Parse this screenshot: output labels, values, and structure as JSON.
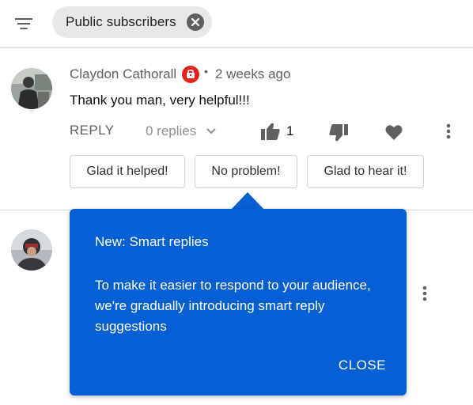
{
  "filter": {
    "chip_label": "Public subscribers",
    "icon": "filter-icon",
    "close_icon": "close-icon"
  },
  "comments": [
    {
      "author": "Claydon Cathorall",
      "badge_icon": "channel-owner-icon",
      "separator": "•",
      "time": "2 weeks ago",
      "text": "Thank you man, very helpful!!!",
      "actions": {
        "reply_label": "REPLY",
        "replies_label": "0 replies",
        "like_count": "1"
      },
      "smart_replies": [
        "Glad it helped!",
        "No problem!",
        "Glad to hear it!"
      ]
    }
  ],
  "popover": {
    "title": "New: Smart replies",
    "body": "To make it easier to respond to your audience, we're gradually introducing smart reply suggestions",
    "close_label": "CLOSE"
  },
  "colors": {
    "accent": "#065fd4",
    "owner_badge": "#e62117",
    "muted_text": "#606060"
  }
}
